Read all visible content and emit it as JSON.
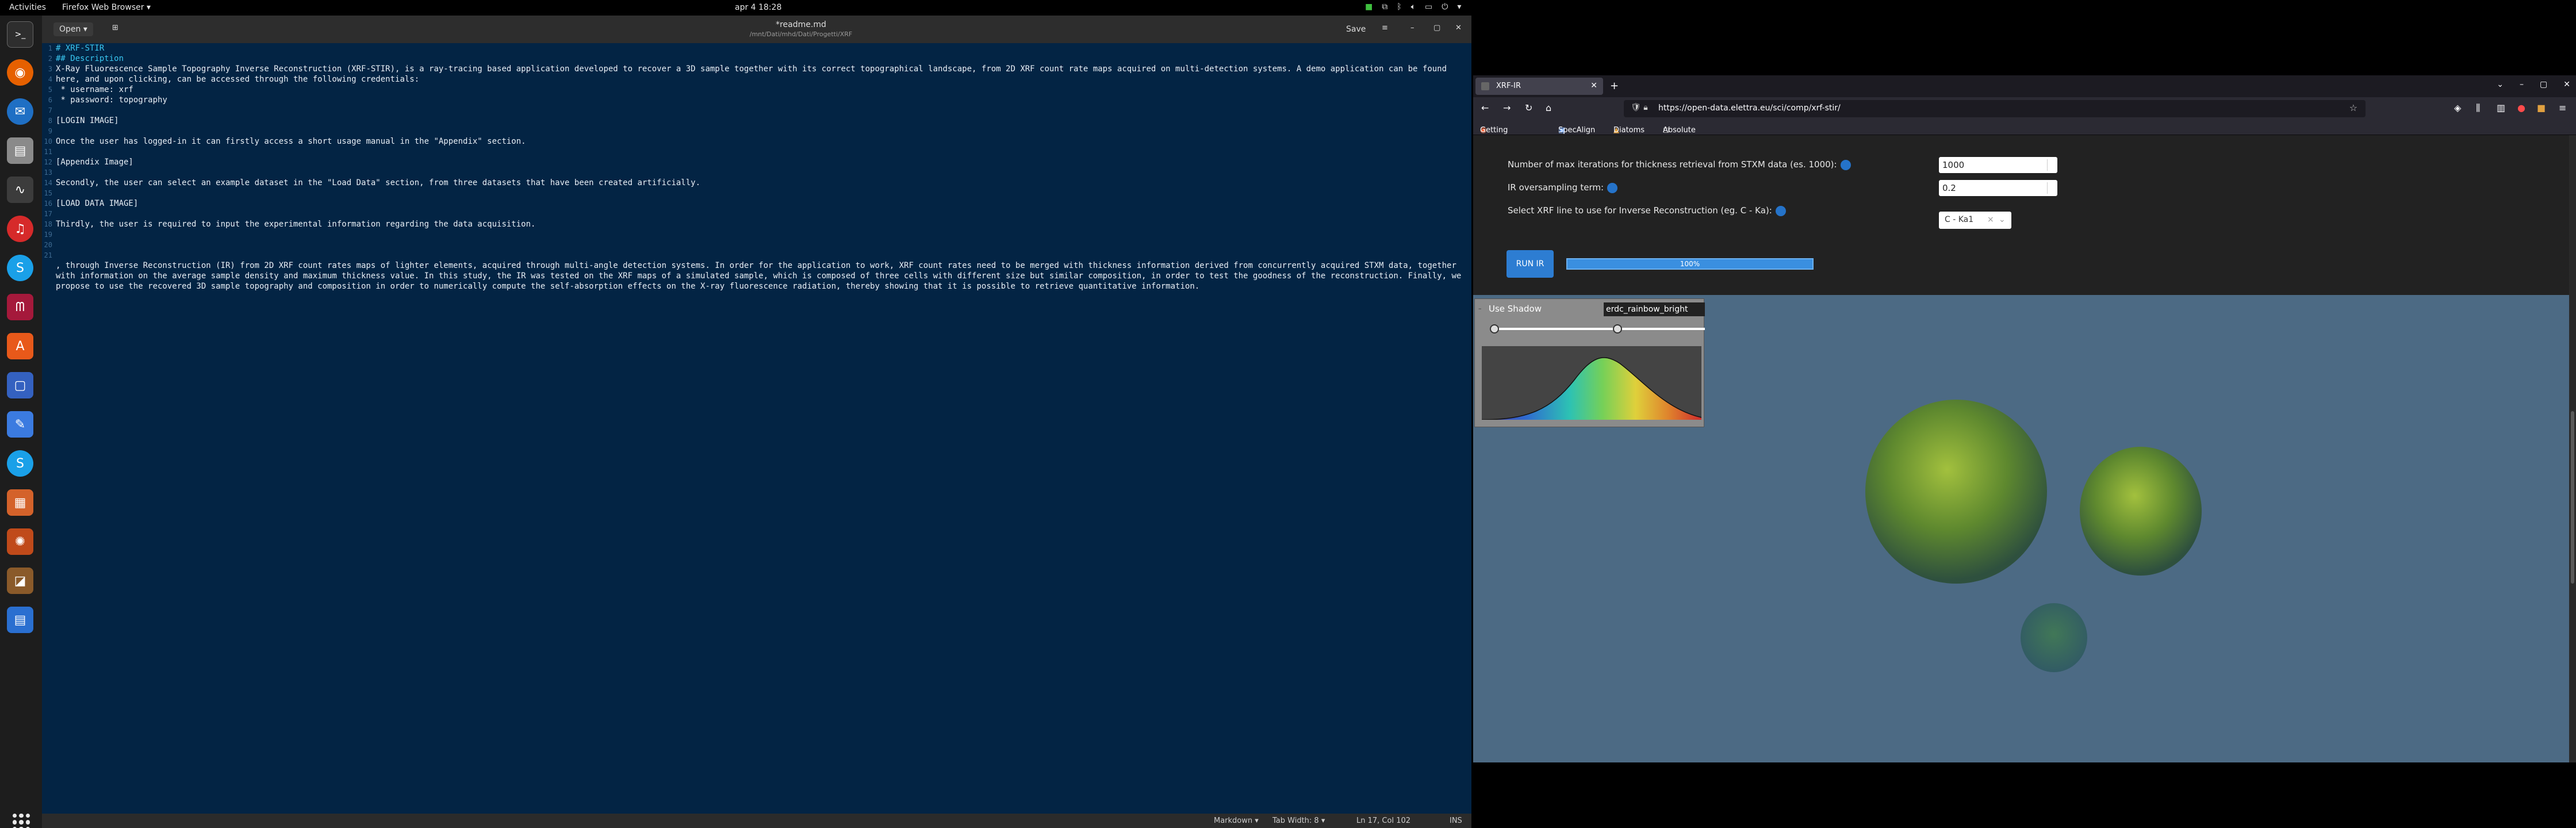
{
  "topbar": {
    "activities": "Activities",
    "app_menu": "Firefox Web Browser ▾",
    "clock": "apr 4  18:28"
  },
  "dock": {
    "items": [
      "terminal-icon",
      "firefox-icon",
      "thunderbird-icon",
      "files-icon",
      "monitor-icon",
      "rhythmbox-icon",
      "skype-icon",
      "mendeley-icon",
      "software-icon",
      "screenshot-icon",
      "text-editor-icon",
      "skype-icon-2",
      "libreoffice-impress-icon",
      "inkscape-icon",
      "photo-icon",
      "libreoffice-writer-icon"
    ]
  },
  "editor": {
    "open_label": "Open",
    "title": "*readme.md",
    "subtitle": "/mnt/Dati/mhd/Dati/Progetti/XRF",
    "save_label": "Save",
    "line_numbers": [
      "1",
      "2",
      "3",
      "4",
      "5",
      "6",
      "7",
      "8",
      "9",
      "10",
      "11",
      "12",
      "13",
      "14",
      "15",
      "16",
      "17",
      "18",
      "19",
      "20",
      "21"
    ],
    "lines": [
      {
        "text": "# XRF-STIR",
        "cls": "h1"
      },
      {
        "text": "## Description",
        "cls": "h2"
      },
      {
        "text": "X-Ray Fluorescence Sample Topography Inverse Reconstruction (XRF-STIR), is a ray-tracing based application developed to recover a 3D sample together with its correct topographical landscape, from 2D XRF count rate maps acquired on multi-detection systems. A demo application can be found here, and upon clicking, can be accessed through the following credentials:",
        "cls": "p"
      },
      {
        "text": " * username: xrf",
        "cls": "p"
      },
      {
        "text": " * password: topography",
        "cls": "p"
      },
      {
        "text": "",
        "cls": "p"
      },
      {
        "text": "[LOGIN IMAGE]",
        "cls": "p"
      },
      {
        "text": "",
        "cls": "p"
      },
      {
        "text": "Once the user has logged-in it can firstly access a short usage manual in the \"Appendix\" section.",
        "cls": "p"
      },
      {
        "text": "",
        "cls": "p"
      },
      {
        "text": "[Appendix Image]",
        "cls": "p"
      },
      {
        "text": "",
        "cls": "p"
      },
      {
        "text": "Secondly, the user can select an example dataset in the \"Load Data\" section, from three datasets that have been created artificially.",
        "cls": "p"
      },
      {
        "text": "",
        "cls": "p"
      },
      {
        "text": "[LOAD DATA IMAGE]",
        "cls": "p"
      },
      {
        "text": "",
        "cls": "p"
      },
      {
        "text": "Thirdly, the user is required to input the experimental information regarding the data acquisition.",
        "cls": "p"
      },
      {
        "text": "",
        "cls": "p"
      },
      {
        "text": "",
        "cls": "p"
      },
      {
        "text": "",
        "cls": "p"
      },
      {
        "text": ", through Inverse Reconstruction (IR) from 2D XRF count rates maps of lighter elements, acquired through multi-angle detection systems. In order for the application to work, XRF count rates need to be merged with thickness information derived from concurrently acquired STXM data, together with information on the average sample density and maximum thickness value. In this study, the IR was tested on the XRF maps of a simulated sample, which is composed of three cells with different size but similar composition, in order to test the goodness of the reconstruction. Finally, we propose to use the recovered 3D sample topography and composition in order to numerically compute the self-absorption effects on the X-ray fluorescence radiation, thereby showing that it is possible to retrieve quantitative information.",
        "cls": "p"
      }
    ],
    "status": {
      "language": "Markdown ▾",
      "tab_width": "Tab Width: 8 ▾",
      "position": "Ln 17, Col 102",
      "mode": "INS"
    }
  },
  "browser": {
    "tab_title": "XRF-IR",
    "url": "https://open-data.elettra.eu/sci/comp/xrf-stir/",
    "bookmarks": [
      "Getting Started",
      "SpecAlign",
      "Diatoms",
      "Absolute paths for da..."
    ],
    "form": {
      "max_iter_label": "Number of max iterations for thickness retrieval from STXM data (es. 1000):",
      "max_iter_value": "1000",
      "oversampling_label": "IR oversampling term:",
      "oversampling_value": "0.2",
      "xrf_line_label": "Select XRF line to use for Inverse Reconstruction (eg. C - Ka):",
      "xrf_line_value": "C - Ka1",
      "run_label": "RUN IR",
      "progress_label": "100%",
      "progress": 1.0
    },
    "viewer": {
      "use_shadow_label": "Use Shadow",
      "colormap_label": "erdc_rainbow_bright"
    }
  },
  "colors": {
    "editor_bg": "#032444",
    "accent": "#2d7dd2",
    "page_bg": "#222222",
    "viewer_bg": "#4c6a84"
  }
}
